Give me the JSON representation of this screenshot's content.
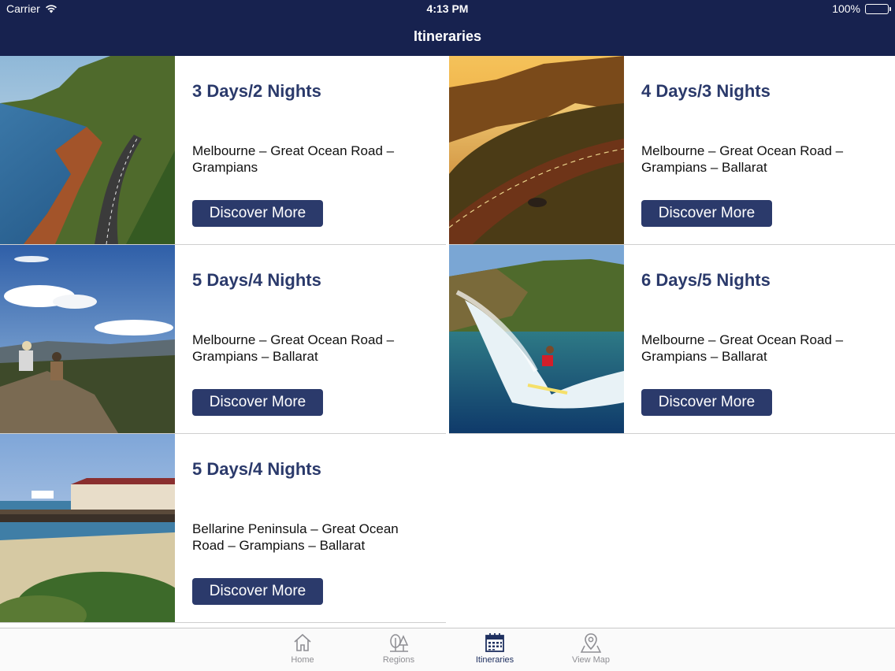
{
  "status_bar": {
    "carrier": "Carrier",
    "time": "4:13 PM",
    "battery": "100%"
  },
  "nav": {
    "title": "Itineraries"
  },
  "colors": {
    "header_bg": "#17224f",
    "accent": "#2b3a6b",
    "tab_inactive": "#8e8e93"
  },
  "cards": [
    {
      "title": "3 Days/2 Nights",
      "description": "Melbourne – Great Ocean Road – Grampians",
      "button": "Discover More",
      "image": "coastal-road-photo"
    },
    {
      "title": "4 Days/3 Nights",
      "description": "Melbourne – Great Ocean Road – Grampians – Ballarat",
      "button": "Discover More",
      "image": "sunset-road-photo"
    },
    {
      "title": "5 Days/4 Nights",
      "description": "Melbourne – Great Ocean Road – Grampians – Ballarat",
      "button": "Discover More",
      "image": "hikers-lookout-photo"
    },
    {
      "title": "6 Days/5 Nights",
      "description": "Melbourne – Great Ocean Road – Grampians – Ballarat",
      "button": "Discover More",
      "image": "surfer-photo"
    },
    {
      "title": "5 Days/4 Nights",
      "description": "Bellarine Peninsula – Great Ocean Road – Grampians – Ballarat",
      "button": "Discover More",
      "image": "pier-photo"
    }
  ],
  "tabs": [
    {
      "label": "Home",
      "icon": "home-icon",
      "active": false
    },
    {
      "label": "Regions",
      "icon": "trees-icon",
      "active": false
    },
    {
      "label": "Itineraries",
      "icon": "calendar-icon",
      "active": true
    },
    {
      "label": "View Map",
      "icon": "map-pin-icon",
      "active": false
    }
  ]
}
